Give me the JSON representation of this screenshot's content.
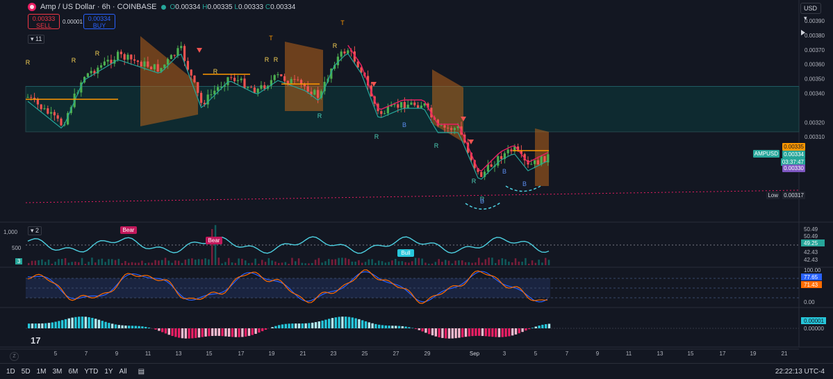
{
  "header": {
    "title": "Amp / US Dollar · 6h · COINBASE",
    "ohlc": [
      {
        "label": "O",
        "value": "0.00334"
      },
      {
        "label": "H",
        "value": "0.00335"
      },
      {
        "label": "L",
        "value": "0.00333"
      },
      {
        "label": "C",
        "value": "0.00334"
      }
    ]
  },
  "trade": {
    "sell_price": "0.00333",
    "sell_label": "SELL",
    "spread": "0.00001",
    "buy_price": "0.00334",
    "buy_label": "BUY"
  },
  "indicators_toggle": "11",
  "currency": "USD",
  "price_axis": {
    "ticks": [
      "0.00390",
      "0.00380",
      "0.00370",
      "0.00360",
      "0.00350",
      "0.00340",
      "0.00320",
      "0.00310"
    ]
  },
  "price_tags": {
    "high_tag": "0.00335",
    "symbol": "AMPUSD",
    "last": "0.00334",
    "countdown": "03:37:47",
    "tag_330": "0.00330",
    "low_label": "Low",
    "low": "0.00317"
  },
  "markers": {
    "r": "R",
    "b": "B",
    "t": "T"
  },
  "pane2": {
    "toggle": "2",
    "left_ticks": [
      "1,000",
      "500"
    ],
    "left_tag": "3",
    "right_ticks": [
      "50.49",
      "50.49",
      "49.25",
      "42.43",
      "42.43"
    ],
    "labels": {
      "bear1": "Bear",
      "bear2": "Bear",
      "bull": "Bull"
    }
  },
  "pane3": {
    "right_ticks": [
      "100.00",
      "77.65",
      "71.43",
      "0.00"
    ]
  },
  "pane4": {
    "right_ticks": [
      "0.00001",
      "0.00000"
    ]
  },
  "time_axis": [
    "5",
    "7",
    "9",
    "11",
    "13",
    "15",
    "17",
    "19",
    "21",
    "23",
    "25",
    "27",
    "29",
    "Sep",
    "3",
    "5",
    "7",
    "9",
    "11",
    "13",
    "15",
    "17",
    "19",
    "21"
  ],
  "bottom_bar": {
    "timeframes": [
      "1D",
      "5D",
      "1M",
      "3M",
      "6M",
      "YTD",
      "1Y",
      "All"
    ],
    "clock": "22:22:13 UTC-4",
    "corner": "Z"
  },
  "colors": {
    "background": "#131722",
    "up": "#26a69a",
    "down": "#f23645",
    "bull_candle": "#4caf50",
    "bear_candle": "#ef5350",
    "channel": "#b8631a",
    "accent_orange": "#ff9800",
    "cyan": "#4dd0e1"
  }
}
